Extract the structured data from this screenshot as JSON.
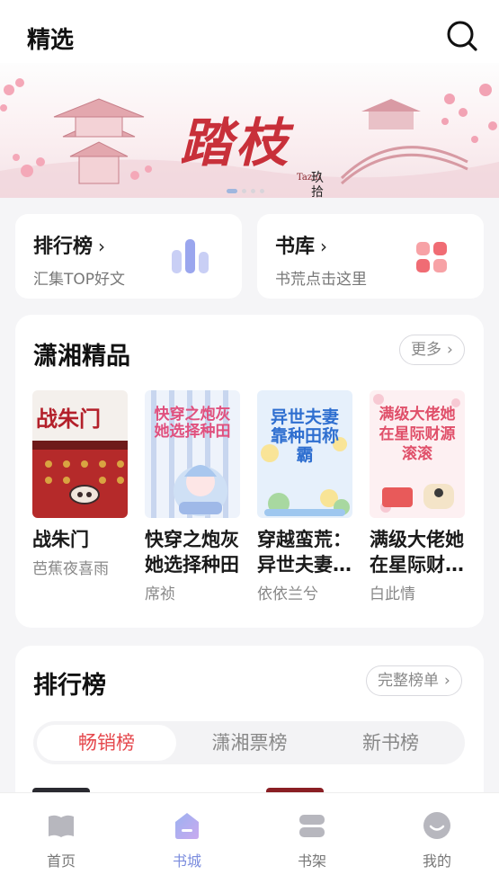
{
  "header": {
    "title": "精选"
  },
  "banner": {
    "title": "踏枝",
    "side_text": "玖拾陆",
    "mini_text": "Tazhi",
    "dot_count": 4,
    "active_dot": 0
  },
  "entries": [
    {
      "title": "排行榜",
      "subtitle": "汇集TOP好文",
      "icon": "bar-chart-icon"
    },
    {
      "title": "书库",
      "subtitle": "书荒点击这里",
      "icon": "grid-icon"
    }
  ],
  "featured": {
    "title": "潇湘精品",
    "more_label": "更多",
    "books": [
      {
        "title": "战朱门",
        "author": "芭蕉夜喜雨",
        "cover_text": "战朱门"
      },
      {
        "title": "快穿之炮灰她选择种田",
        "author": "席祯",
        "cover_text": "快穿之炮灰她选择种田"
      },
      {
        "title": "穿越蛮荒：异世夫妻靠种田称霸",
        "author": "依依兰兮",
        "cover_text": "异世夫妻靠种田称霸"
      },
      {
        "title": "满级大佬她在星际财源滚滚",
        "author": "白此情",
        "cover_text": "满级大佬她在星际财源滚滚"
      }
    ]
  },
  "ranking": {
    "title": "排行榜",
    "full_list_label": "完整榜单",
    "tabs": [
      "畅销榜",
      "潇湘票榜",
      "新书榜"
    ],
    "active_tab": 0
  },
  "bottom_nav": {
    "items": [
      {
        "label": "首页",
        "icon": "book-open-icon"
      },
      {
        "label": "书城",
        "icon": "store-icon"
      },
      {
        "label": "书架",
        "icon": "bookshelf-icon"
      },
      {
        "label": "我的",
        "icon": "profile-icon"
      }
    ],
    "active": 1
  },
  "colors": {
    "accent_red": "#e5484d",
    "accent_blue": "#7b8cde",
    "banner_red": "#c8303a"
  }
}
